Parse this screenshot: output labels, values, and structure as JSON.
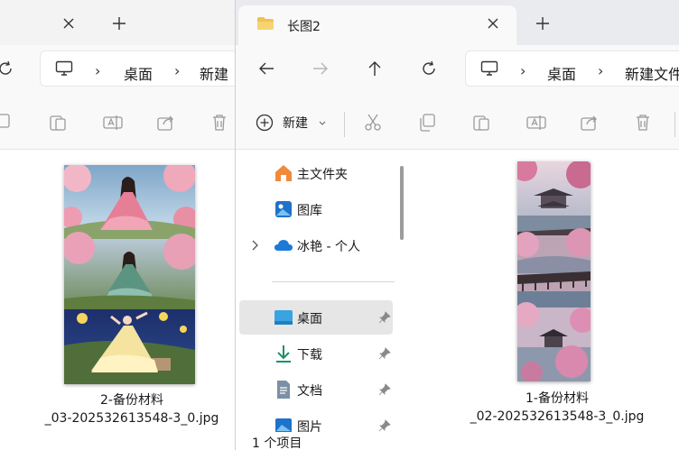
{
  "back_window": {
    "address_crumbs": [
      "桌面",
      "新建"
    ],
    "file": {
      "name_line1": "2-备份材料",
      "name_line2": "_03-202532613548-3_0.jpg"
    }
  },
  "front_window": {
    "tab": {
      "title": "长图2"
    },
    "address_crumbs": [
      "桌面",
      "新建文件"
    ],
    "toolbar": {
      "new_label": "新建"
    },
    "sidebar": {
      "items": [
        {
          "label": "主文件夹",
          "icon": "home-icon"
        },
        {
          "label": "图库",
          "icon": "gallery-icon"
        },
        {
          "label": "冰艳 - 个人",
          "icon": "cloud-icon"
        },
        {
          "label": "桌面",
          "icon": "desktop-icon"
        },
        {
          "label": "下载",
          "icon": "download-icon"
        },
        {
          "label": "文档",
          "icon": "document-icon"
        },
        {
          "label": "图片",
          "icon": "pictures-icon"
        }
      ]
    },
    "file": {
      "name_line1": "1-备份材料",
      "name_line2": "_02-202532613548-3_0.jpg"
    },
    "status": {
      "item_count": "1 个项目"
    }
  },
  "colors": {
    "accent": "#0067c0",
    "icon_gray": "#9a9a9a",
    "selected_bg": "#e6e6e6",
    "folder_yellow": "#f2c14e"
  }
}
